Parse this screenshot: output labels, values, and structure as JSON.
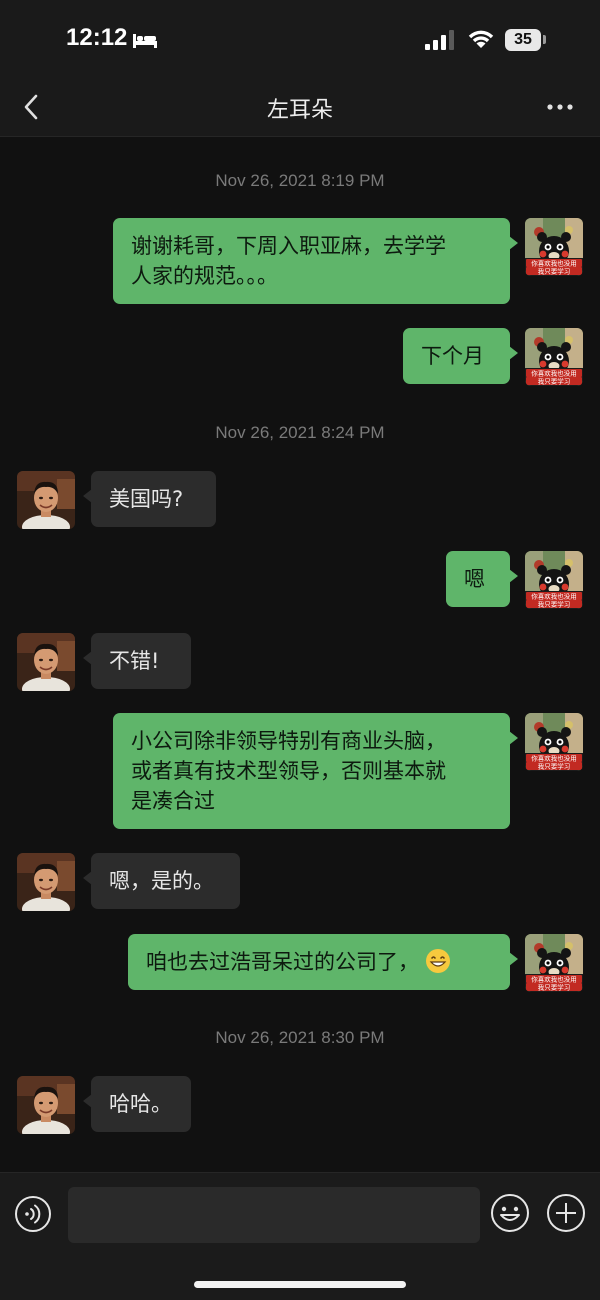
{
  "status_bar": {
    "time": "12:12",
    "battery": "35"
  },
  "nav": {
    "title": "左耳朵"
  },
  "messages": {
    "ts1": "Nov 26, 2021 8:19 PM",
    "m1_line1": "谢谢耗哥，下周入职亚麻，去学学",
    "m1_line2": "人家的规范。。。",
    "m2": "下个月",
    "ts2": "Nov 26, 2021 8:24 PM",
    "m3": "美国吗?",
    "m4": "嗯",
    "m5": "不错!",
    "m6_line1": "小公司除非领导特别有商业头脑，",
    "m6_line2": "或者真有技术型领导，否则基本就",
    "m6_line3": "是凑合过",
    "m7": "嗯，是的。",
    "m8": "咱也去过浩哥呆过的公司了，",
    "ts3": "Nov 26, 2021 8:30 PM",
    "m9": "哈哈。"
  },
  "sticker": {
    "line1": "你喜欢我也没用",
    "line2": "我只要学习"
  },
  "colors": {
    "outgoing_bubble": "#5fb56a",
    "incoming_bubble": "#2c2c2c",
    "background": "#111111"
  },
  "icons": [
    "bed-icon",
    "signal-icon",
    "wifi-icon",
    "back-icon",
    "more-icon",
    "voice-icon",
    "emoji-icon",
    "plus-icon",
    "grin-emoji-icon"
  ]
}
